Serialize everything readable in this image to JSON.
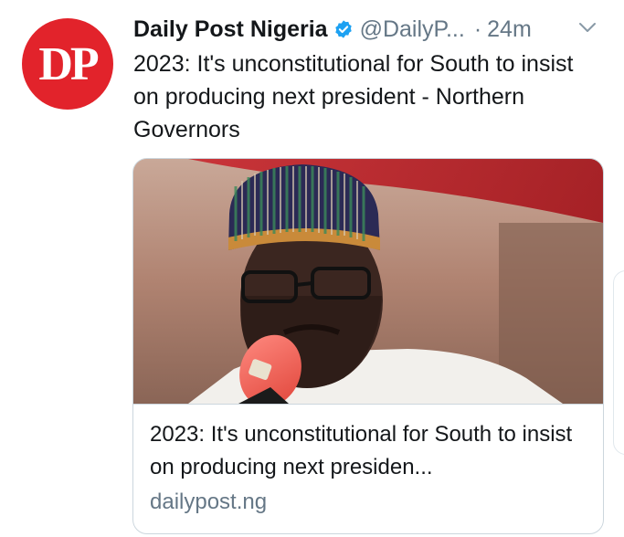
{
  "tweet": {
    "author_logo_text": "DP",
    "author_name": "Daily Post Nigeria",
    "handle": "@DailyP...",
    "separator": "·",
    "time": "24m",
    "text": "2023: It's unconstitutional for South to insist on producing next president - Northern Governors"
  },
  "card": {
    "title": "2023: It's unconstitutional for South to insist on producing next presiden...",
    "domain": "dailypost.ng"
  },
  "icons": {
    "verified": "verified-badge-icon",
    "more": "chevron-down-icon"
  },
  "colors": {
    "brand_red": "#e2232b",
    "verified_blue": "#1da1f2",
    "secondary_text": "#657786",
    "border": "#ccd6dd"
  }
}
